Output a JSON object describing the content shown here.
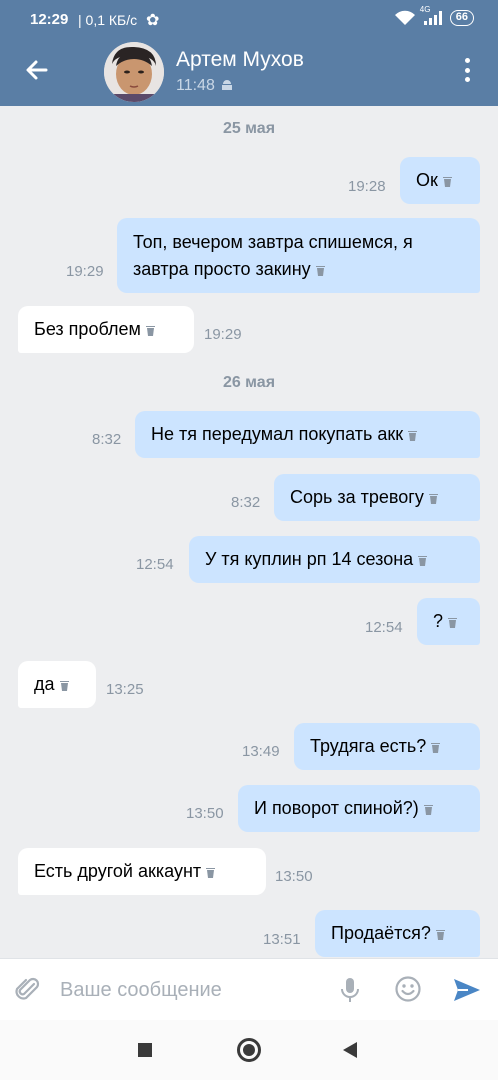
{
  "status_bar": {
    "time": "12:29",
    "speed": "| 0,1 КБ/с",
    "network": "4G",
    "battery": "66"
  },
  "header": {
    "name": "Артем Мухов",
    "last_seen": "11:48"
  },
  "chat": {
    "dates": [
      "25 мая",
      "26 мая"
    ],
    "messages": [
      {
        "dir": "out",
        "text": "Ок",
        "time": "19:28"
      },
      {
        "dir": "out",
        "text_line1": "Топ, вечером завтра спишемся, я",
        "text_line2": "завтра просто закину",
        "time": "19:29"
      },
      {
        "dir": "in",
        "text": "Без проблем",
        "time": "19:29"
      },
      {
        "dir": "out",
        "text": "Не тя передумал покупать акк",
        "time": "8:32"
      },
      {
        "dir": "out",
        "text": "Сорь за тревогу",
        "time": "8:32"
      },
      {
        "dir": "out",
        "text": "У тя куплин рп 14 сезона",
        "time": "12:54"
      },
      {
        "dir": "out",
        "text": "?",
        "time": "12:54"
      },
      {
        "dir": "in",
        "text": "да",
        "time": "13:25"
      },
      {
        "dir": "out",
        "text": "Трудяга есть?",
        "time": "13:49"
      },
      {
        "dir": "out",
        "text": "И поворот спиной?)",
        "time": "13:50"
      },
      {
        "dir": "in",
        "text": "Есть другой аккаунт",
        "time": "13:50"
      },
      {
        "dir": "out",
        "text": "Продаётся?",
        "time": "13:51"
      }
    ]
  },
  "composer": {
    "placeholder": "Ваше сообщение"
  },
  "colors": {
    "header_bg": "#5a7ea5",
    "outgoing_bubble": "#cce4ff",
    "incoming_bubble": "#ffffff",
    "chat_bg": "#edeef0",
    "send_icon": "#4a86c5"
  }
}
